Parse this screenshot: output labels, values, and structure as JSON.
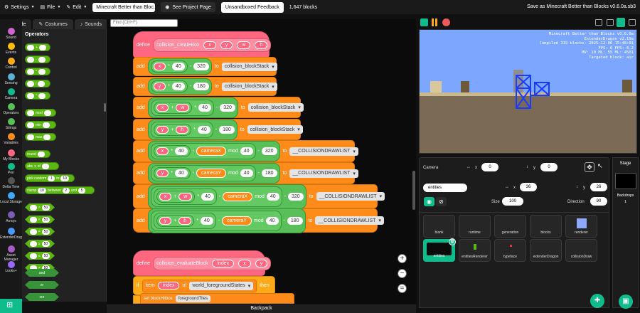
{
  "menubar": {
    "settings": "Settings",
    "file": "File",
    "edit": "Edit",
    "project_title": "Minecraft Better than Bloc...",
    "see_project_page": "See Project Page",
    "unsandboxed_feedback": "Unsandboxed Feedback",
    "block_count": "1,647 blocks",
    "save_as": "Save as Minecraft Better than Blocks v0.6.0a.sb3"
  },
  "tabs": {
    "code": "Code",
    "costumes": "Costumes",
    "sounds": "Sounds"
  },
  "categories": [
    {
      "label": "Sound",
      "color": "#cf63cf"
    },
    {
      "label": "Events",
      "color": "#ffbf00"
    },
    {
      "label": "Control",
      "color": "#ffab19"
    },
    {
      "label": "Sensing",
      "color": "#5cb1d6"
    },
    {
      "label": "Camera",
      "color": "#0fbd8c"
    },
    {
      "label": "Operators",
      "color": "#59c059"
    },
    {
      "label": "Strings",
      "color": "#59c059"
    },
    {
      "label": "Variables",
      "color": "#ff8c1a"
    },
    {
      "label": "My Blocks",
      "color": "#ff6680"
    },
    {
      "label": "Pen",
      "color": "#0fbd8c"
    },
    {
      "label": "Delta Time",
      "color": "#555555"
    },
    {
      "label": "Local Storage",
      "color": "#3fa9f5"
    },
    {
      "label": "Arrays",
      "color": "#7d5cb8"
    },
    {
      "label": "ExtenderDragonUtil",
      "color": "#4c97ff"
    },
    {
      "label": "Asset Manager",
      "color": "#a75cc9"
    },
    {
      "label": "Looks+",
      "color": "#9966ff"
    }
  ],
  "palette": {
    "title": "Operators",
    "ops": [
      "+",
      "-",
      "*",
      "/",
      "^"
    ],
    "mod": "mod",
    "min": "min",
    "max": "max",
    "round": "round",
    "abs": "abs",
    "of": "of",
    "pick_random": "pick random",
    "pick_a": "1",
    "pick_to": "to",
    "pick_b": "10",
    "clamp": "clamp",
    "clamp_v": "10",
    "between": "between",
    "clamp_a": "2",
    "and": "and",
    "clamp_b": "5",
    "cmp": [
      ">",
      "<",
      "=",
      "≥",
      "≤",
      "≠"
    ],
    "cmp_val": "50",
    "bool_and": "and",
    "bool_or": "or",
    "bool_xor": "xor"
  },
  "search": {
    "placeholder": "Find (Ctrl+F)"
  },
  "script1": {
    "define": "define",
    "name": "collision_createBox",
    "args": [
      "x",
      "y",
      "w",
      "h"
    ],
    "add": "add",
    "to": "to",
    "mod": "mod",
    "n40": "40",
    "n320": "320",
    "n180": "180",
    "blockstack": "collision_blockStack",
    "drawlist": "__COLLISIONDRAWLIST",
    "camx": "cameraX",
    "camy": "cameraY"
  },
  "script2": {
    "define": "define",
    "name": "collision_evaluateBlock",
    "args": [
      "index",
      "x",
      "y"
    ],
    "if": "if",
    "item": "item",
    "of": "of",
    "list": "world_foregroundStates",
    "then": "then",
    "partial": "set blockHitbox",
    "partial2": "foregroundTiles"
  },
  "backpack": "Backpack",
  "stage_hud": [
    "Minecraft Better than Blocks v0.6.0a",
    "ExtenderDragon v2.19a",
    "Compiled 319 blocks: 2025-12-06 15:48:01",
    "FPS: 6  FPS: 6.2",
    "MV: 10  ML: 55  ML: 4501",
    "Targeted block: air"
  ],
  "sprite_info": {
    "camera_label": "Camera",
    "x_label": "x",
    "x_val": "0",
    "y_label": "y",
    "y_val": "0",
    "sprite_name": "entities",
    "sx_label": "x",
    "sx_val": "36",
    "sy_label": "y",
    "sy_val": "26",
    "size_label": "Size",
    "size_val": "100",
    "dir_label": "Direction",
    "dir_val": "90"
  },
  "sprites": [
    "blank",
    "runtime",
    "generation",
    "blocks",
    "renderer",
    "entities",
    "entitiesRenderer",
    "typeface",
    "extenderDragon",
    "collisionDraw"
  ],
  "stage_panel": {
    "title": "Stage",
    "backdrops_label": "Backdrops",
    "backdrops_count": "1"
  }
}
